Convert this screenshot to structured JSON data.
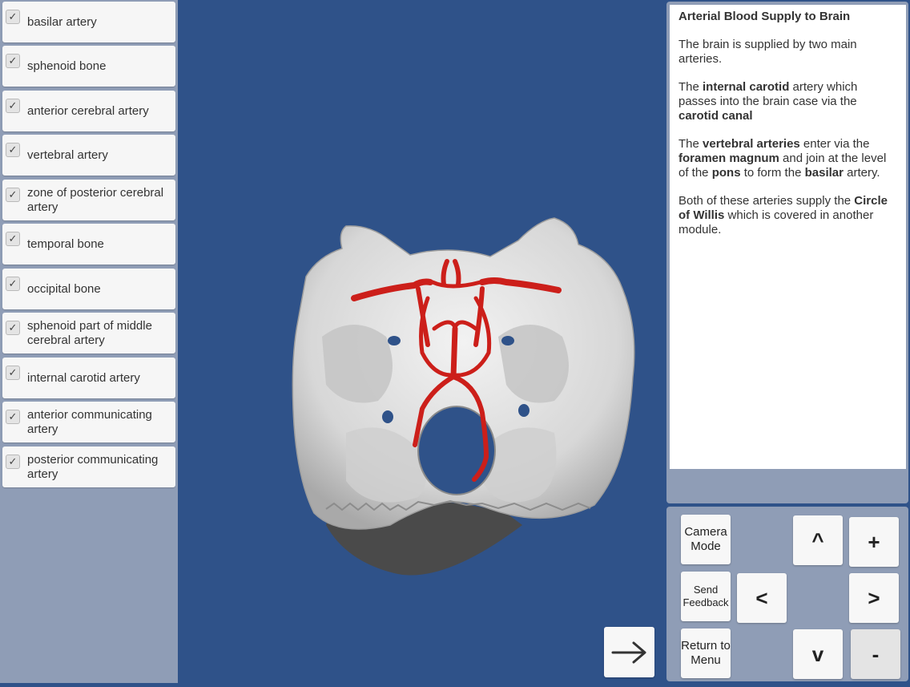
{
  "layers": [
    {
      "label": "basilar artery",
      "checked": true
    },
    {
      "label": "sphenoid bone",
      "checked": true
    },
    {
      "label": "anterior cerebral artery",
      "checked": true
    },
    {
      "label": "vertebral artery",
      "checked": true
    },
    {
      "label": "zone of posterior cerebral artery",
      "checked": true
    },
    {
      "label": "temporal bone",
      "checked": true
    },
    {
      "label": "occipital bone",
      "checked": true
    },
    {
      "label": "sphenoid part of middle cerebral artery",
      "checked": true
    },
    {
      "label": "internal carotid artery",
      "checked": true
    },
    {
      "label": "anterior communicating artery",
      "checked": true
    },
    {
      "label": "posterior communicating artery",
      "checked": true
    }
  ],
  "info": {
    "title": "Arterial Blood Supply to Brain",
    "p1": "The brain is supplied by two main arteries.",
    "p2": {
      "a": "The ",
      "b": "internal carotid",
      "c": " artery which passes into the brain case via the ",
      "d": "carotid canal"
    },
    "p3": {
      "a": "The ",
      "b": "vertebral arteries",
      "c": " enter via the ",
      "d": "foramen magnum",
      "e": " and join at the level of the ",
      "f": "pons",
      "g": " to form the ",
      "h": "basilar",
      "i": " artery."
    },
    "p4": {
      "a": "Both of these arteries supply the ",
      "b": "Circle of Willis",
      "c": " which is covered in another module."
    }
  },
  "controls": {
    "camera_mode": "Camera Mode",
    "send_feedback": "Send Feedback",
    "return_menu": "Return to Menu",
    "up": "^",
    "down": "v",
    "left": "<",
    "right": ">",
    "zoom_in": "+",
    "zoom_out": "-"
  },
  "icons": {
    "check": "checkmark-icon",
    "next": "arrow-right-icon"
  },
  "colors": {
    "background": "#2f5289",
    "panel": "#8f9db6",
    "artery": "#cc1f1a",
    "bone": "#e6e6e6"
  }
}
